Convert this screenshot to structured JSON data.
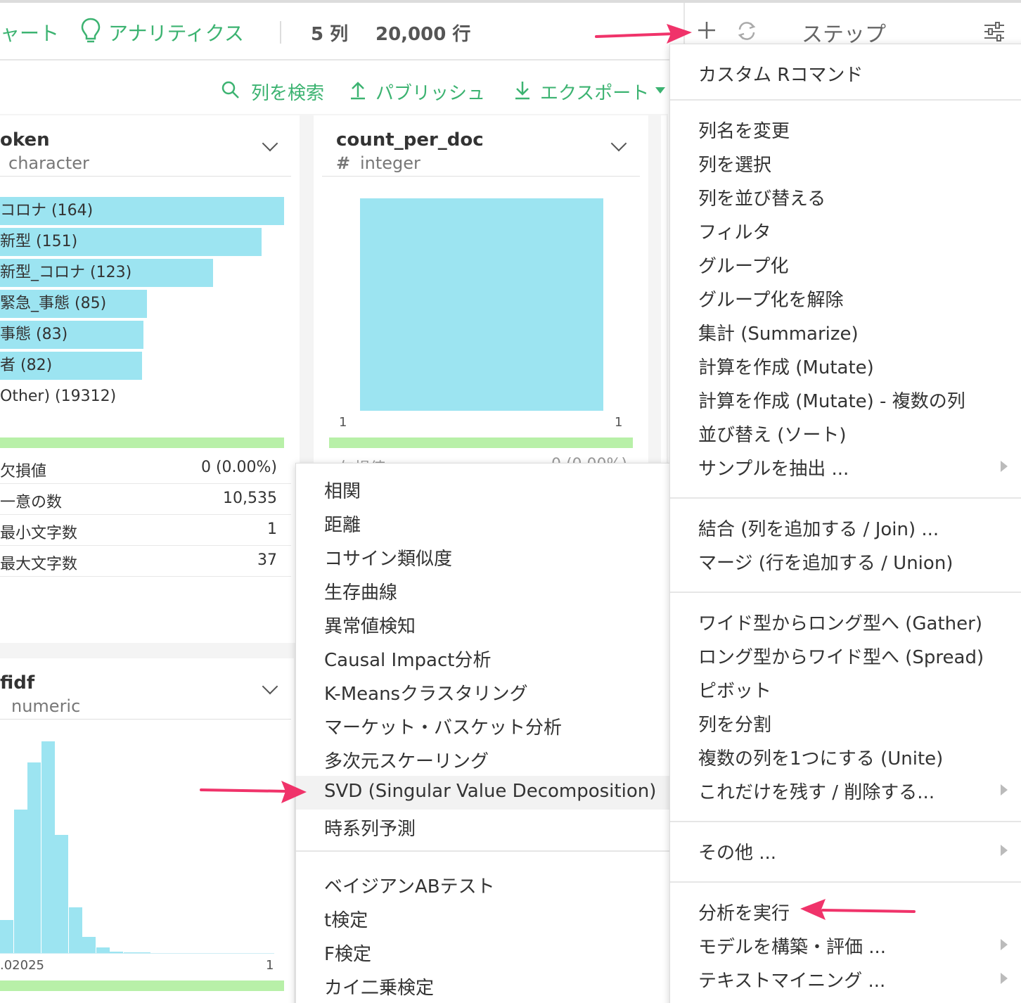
{
  "toolbar": {
    "chart_tab_label": "ャート",
    "analytics_tab_label": "アナリティクス",
    "columns_count": "5 列",
    "rows_count": "20,000 行",
    "steps_label": "ステップ"
  },
  "actions": {
    "search_label": "列を検索",
    "publish_label": "パブリッシュ",
    "export_label": "エクスポート"
  },
  "token_column": {
    "name": "oken",
    "type": "character",
    "bars": [
      {
        "label": "コロナ (164)",
        "value": 164
      },
      {
        "label": "新型 (151)",
        "value": 151
      },
      {
        "label": "新型_コロナ (123)",
        "value": 123
      },
      {
        "label": "緊急_事態 (85)",
        "value": 85
      },
      {
        "label": "事態 (83)",
        "value": 83
      },
      {
        "label": "者 (82)",
        "value": 82
      }
    ],
    "other_label": "Other) (19312)",
    "stats": [
      {
        "label": "欠損値",
        "value": "0 (0.00%)"
      },
      {
        "label": "一意の数",
        "value": "10,535"
      },
      {
        "label": "最小文字数",
        "value": "1"
      },
      {
        "label": "最大文字数",
        "value": "37"
      }
    ]
  },
  "count_column": {
    "name": "count_per_doc",
    "type_icon": "#",
    "type": "integer",
    "axis_min": "1",
    "axis_max": "1",
    "hidden_stat_label": "欠損値",
    "hidden_stat_value": "0 (0.00%)"
  },
  "tfidf_column": {
    "name": "fidf",
    "type": "numeric",
    "axis_min": ".02025",
    "axis_max": "1",
    "histogram": [
      0.16,
      0.68,
      0.9,
      1.0,
      0.56,
      0.22,
      0.08,
      0.03,
      0.01,
      0.005,
      0.005,
      0.004,
      0.004,
      0.003,
      0.003,
      0.003,
      0.003,
      0.003,
      0.003,
      0.003
    ]
  },
  "analytics_menu": {
    "groups": [
      [
        "相関",
        "距離",
        "コサイン類似度",
        "生存曲線",
        "異常値検知",
        "Causal Impact分析",
        "K-Meansクラスタリング",
        "マーケット・バスケット分析",
        "多次元スケーリング",
        "SVD (Singular Value Decomposition)",
        "時系列予測"
      ],
      [
        "ベイジアンABテスト",
        "t検定",
        "F検定",
        "カイ二乗検定"
      ]
    ],
    "highlighted": "SVD (Singular Value Decomposition)"
  },
  "step_menu": {
    "custom_r": "カスタム Rコマンド",
    "group1": [
      "列名を変更",
      "列を選択",
      "列を並び替える",
      "フィルタ",
      "グループ化",
      "グループ化を解除",
      "集計 (Summarize)",
      "計算を作成 (Mutate)",
      "計算を作成 (Mutate) - 複数の列",
      "並び替え (ソート)",
      "サンプルを抽出 ..."
    ],
    "group2": [
      "結合 (列を追加する / Join) ...",
      "マージ (行を追加する / Union)"
    ],
    "group3": [
      "ワイド型からロング型へ (Gather)",
      "ロング型からワイド型へ (Spread)",
      "ピボット",
      "列を分割",
      "複数の列を1つにする (Unite)",
      "これだけを残す / 削除する..."
    ],
    "other": "その他 ...",
    "group5": [
      "分析を実行",
      "モデルを構築・評価 ...",
      "テキストマイニング ..."
    ]
  },
  "colors": {
    "accent_green": "#3cb371",
    "bar_blue": "#9ce4f1",
    "strip_green": "#b8f0a8",
    "arrow_pink": "#f0336a"
  }
}
